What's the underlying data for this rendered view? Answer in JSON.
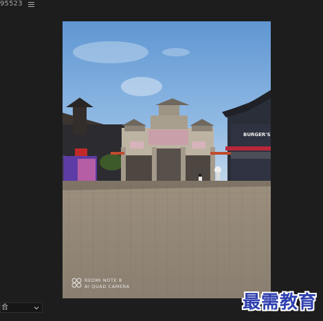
{
  "top_bar": {
    "title": "95523",
    "menu_icon": "hamburger-menu-icon"
  },
  "viewer": {
    "watermark_line1": "REDMI NOTE 8",
    "watermark_line2": "AI QUAD CAMERA",
    "shop_sign": "BURGER'S"
  },
  "bottom_bar": {
    "dropdown_value": "合",
    "dropdown_icon": "chevron-down-icon"
  },
  "brand": {
    "text": "最需教育"
  }
}
